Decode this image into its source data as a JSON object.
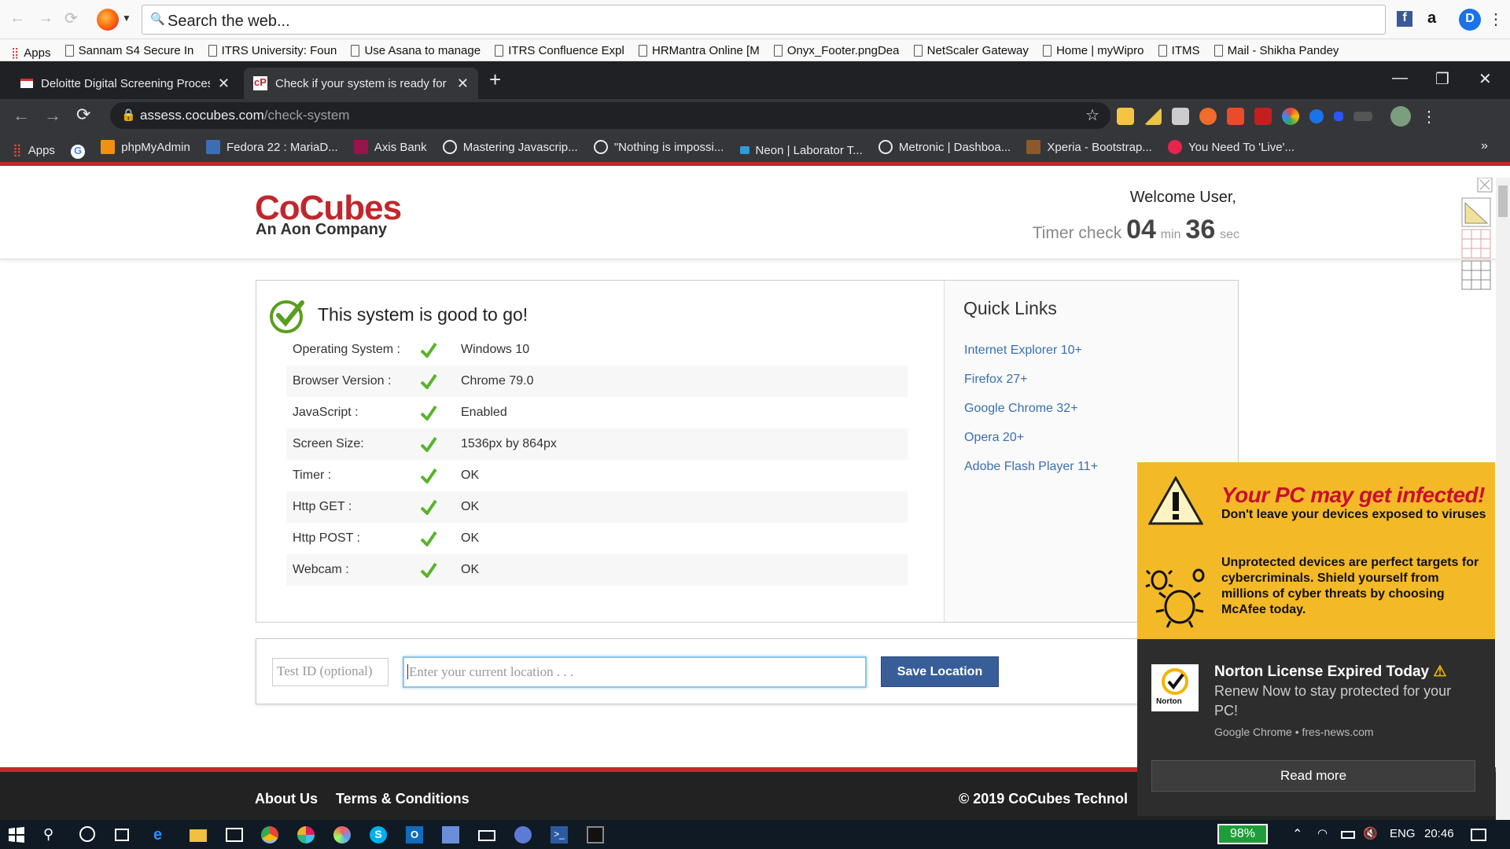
{
  "firefox": {
    "search_placeholder": "Search the web...",
    "bookmarks": [
      "Apps",
      "Sannam S4 Secure In",
      "ITRS University: Foun",
      "Use Asana to manage",
      "ITRS Confluence Expl",
      "HRMantra Online [M",
      "Onyx_Footer.pngDea",
      "NetScaler Gateway",
      "Home | myWipro",
      "ITMS",
      "Mail - Shikha Pandey"
    ]
  },
  "chrome": {
    "tabs": [
      {
        "title": "Deloitte Digital Screening Proces",
        "icon": "gmail-icon"
      },
      {
        "title": "Check if your system is ready for",
        "icon": "cocubes-icon"
      }
    ],
    "url_host": "assess.cocubes.com",
    "url_path": "/check-system",
    "bookmarks": [
      "Apps",
      "phpMyAdmin",
      "Fedora 22 : MariaD...",
      "Axis Bank",
      "Mastering Javascrip...",
      "\"Nothing is impossi...",
      "Neon | Laborator T...",
      "Metronic | Dashboa...",
      "Xperia - Bootstrap...",
      "You Need To 'Live'..."
    ]
  },
  "header": {
    "logo": "CoCubes",
    "logo_sub": "An Aon Company",
    "welcome": "Welcome User,",
    "timer_label": "Timer check",
    "timer_min": "04",
    "min_unit": "min",
    "timer_sec": "36",
    "sec_unit": "sec"
  },
  "status": {
    "title": "This system is good to go!",
    "rows": [
      {
        "label": "Operating System :",
        "value": "Windows 10"
      },
      {
        "label": "Browser Version :",
        "value": "Chrome 79.0"
      },
      {
        "label": "JavaScript :",
        "value": "Enabled"
      },
      {
        "label": "Screen Size:",
        "value": "1536px by 864px"
      },
      {
        "label": "Timer :",
        "value": "OK"
      },
      {
        "label": "Http GET :",
        "value": "OK"
      },
      {
        "label": "Http POST :",
        "value": "OK"
      },
      {
        "label": "Webcam :",
        "value": "OK"
      }
    ]
  },
  "quick_links": {
    "title": "Quick Links",
    "links": [
      "Internet Explorer 10+",
      "Firefox 27+",
      "Google Chrome 32+",
      "Opera 20+",
      "Adobe Flash Player 11+"
    ]
  },
  "location": {
    "test_id_placeholder": "Test ID (optional)",
    "location_placeholder": "Enter your current location . . .",
    "save_label": "Save Location"
  },
  "footer": {
    "about": "About Us",
    "terms": "Terms & Conditions",
    "copyright": "© 2019 CoCubes Technol"
  },
  "mcafee": {
    "title": "Your PC may get infected!",
    "subtitle": "Don't leave your devices exposed to viruses",
    "body": "Unprotected devices are perfect targets for cybercriminals. Shield yourself from millions of cyber threats by choosing McAfee today."
  },
  "norton": {
    "title": "Norton License Expired Today",
    "body": "Renew Now to stay protected for your PC!",
    "source": "Google Chrome • fres-news.com",
    "button": "Read more",
    "logo_text": "Norton"
  },
  "taskbar": {
    "battery": "98%",
    "language": "ENG",
    "time": "20:46"
  }
}
